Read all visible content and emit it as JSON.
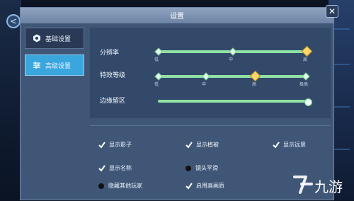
{
  "window": {
    "title": "设置",
    "close_glyph": "✕"
  },
  "back_glyph": "<",
  "sidebar": {
    "items": [
      {
        "label": "基础设置",
        "icon": "hexagon-gear-icon",
        "selected": false
      },
      {
        "label": "高级设置",
        "icon": "sliders-icon",
        "selected": true
      }
    ]
  },
  "settings": {
    "resolution": {
      "label": "分辨率",
      "options": [
        "低",
        "中",
        "高"
      ],
      "selected": "高"
    },
    "effects": {
      "label": "特效等级",
      "options": [
        "低",
        "中",
        "高",
        "极高"
      ],
      "selected": "高"
    },
    "margin": {
      "label": "边缘留区",
      "value": 1.0
    }
  },
  "checkboxes": [
    {
      "label": "显示影子",
      "checked": true
    },
    {
      "label": "显示植被",
      "checked": true
    },
    {
      "label": "显示远景",
      "checked": true
    },
    {
      "label": "显示名称",
      "checked": true
    },
    {
      "label": "镜头平滑",
      "checked": false
    },
    {
      "label": "隐藏其他玩家",
      "checked": false
    },
    {
      "label": "启用高画质",
      "checked": true
    }
  ],
  "watermark": {
    "text": "九游"
  },
  "colors": {
    "accent_blue": "#3aa6de",
    "track_green": "#8fe2a4",
    "selected_gold": "#ffd86a"
  }
}
